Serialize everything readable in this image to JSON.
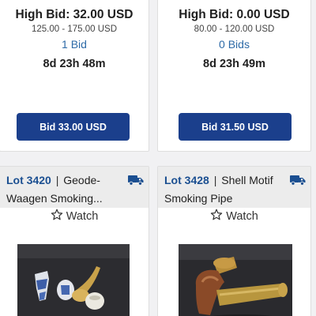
{
  "lots": [
    {
      "high_bid": "High Bid: 32.00 USD",
      "estimate": "125.00 - 175.00 USD",
      "bids": "1 Bid",
      "time_left": "8d 23h 48m",
      "bid_button": "Bid 33.00 USD"
    },
    {
      "high_bid": "High Bid: 0.00 USD",
      "estimate": "80.00 - 120.00 USD",
      "bids": "0 Bids",
      "time_left": "8d 23h 49m",
      "bid_button": "Bid 31.50 USD"
    },
    {
      "lot_number": "Lot 3420",
      "separator": "|",
      "title": "Geode-Waagen Smoking...",
      "watch_label": "Watch",
      "icon": "truck-icon",
      "watch_icon": "star-outline-icon"
    },
    {
      "lot_number": "Lot 3428",
      "separator": "|",
      "title": "Shell Motif Smoking Pipe",
      "watch_label": "Watch",
      "icon": "truck-icon",
      "watch_icon": "star-outline-icon"
    }
  ],
  "colors": {
    "accent_button": "#1b3f8c",
    "lot_number": "#1b4f91",
    "bids_link": "#2d6aa7",
    "header_bg": "#ececec"
  }
}
